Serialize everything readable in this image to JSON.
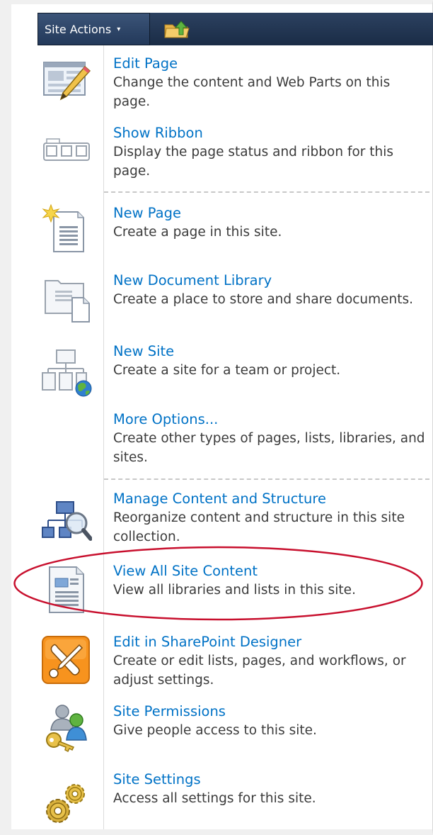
{
  "toolbar": {
    "site_actions_label": "Site Actions",
    "caret": "▾"
  },
  "menu": {
    "items": [
      {
        "title": "Edit Page",
        "desc": "Change the content and Web Parts on this page."
      },
      {
        "title": "Show Ribbon",
        "desc": "Display the page status and ribbon for this page."
      },
      {
        "title": "New Page",
        "desc": "Create a page in this site."
      },
      {
        "title": "New Document Library",
        "desc": "Create a place to store and share documents."
      },
      {
        "title": "New Site",
        "desc": "Create a site for a team or project."
      },
      {
        "title": "More Options...",
        "desc": "Create other types of pages, lists, libraries, and sites."
      },
      {
        "title": "Manage Content and Structure",
        "desc": "Reorganize content and structure in this site collection."
      },
      {
        "title": "View All Site Content",
        "desc": "View all libraries and lists in this site."
      },
      {
        "title": "Edit in SharePoint Designer",
        "desc": "Create or edit lists, pages, and workflows, or adjust settings."
      },
      {
        "title": "Site Permissions",
        "desc": "Give people access to this site."
      },
      {
        "title": "Site Settings",
        "desc": "Access all settings for this site."
      }
    ]
  },
  "colors": {
    "link": "#0072c6",
    "description": "#3b3b3b",
    "toolbar": "#1f3350",
    "highlight_circle": "#c8102e",
    "designer_icon": "#f7931e"
  }
}
